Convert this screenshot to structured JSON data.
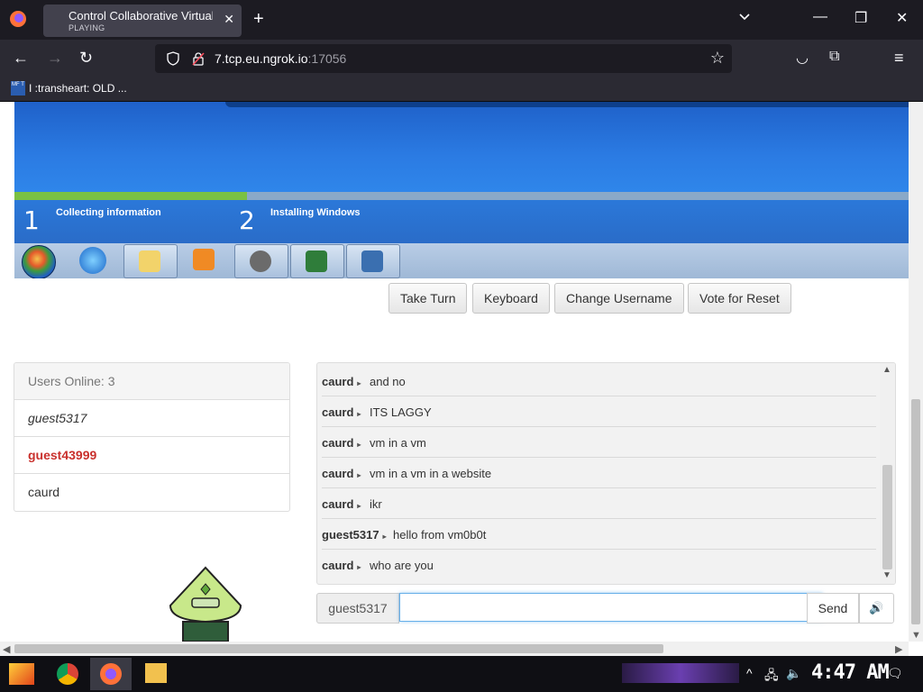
{
  "browser": {
    "tab_title": "Control Collaborative Virtual",
    "tab_subtitle": "PLAYING",
    "url_host": "7.tcp.eu.ngrok.io",
    "url_port": ":17056",
    "bookmark_label": "I :transheart: OLD ...",
    "bookmark_icon_text": "MF T"
  },
  "vm": {
    "progress_fraction": 0.26,
    "steps": [
      {
        "num": "1",
        "label": "Collecting information"
      },
      {
        "num": "2",
        "label": "Installing Windows"
      }
    ]
  },
  "controls": {
    "take_turn": "Take Turn",
    "keyboard": "Keyboard",
    "change_username": "Change Username",
    "vote_reset": "Vote for Reset"
  },
  "users": {
    "header": "Users Online: 3",
    "list": [
      {
        "name": "guest5317"
      },
      {
        "name": "guest43999"
      },
      {
        "name": "caurd"
      }
    ]
  },
  "chat": {
    "messages": [
      {
        "user": "caurd",
        "text": "and no"
      },
      {
        "user": "caurd",
        "text": "ITS LAGGY"
      },
      {
        "user": "caurd",
        "text": "vm in a vm"
      },
      {
        "user": "caurd",
        "text": "vm in a vm in a website"
      },
      {
        "user": "caurd",
        "text": "ikr"
      },
      {
        "user": "guest5317",
        "text": "hello from vm0b0t"
      },
      {
        "user": "caurd",
        "text": "who are you"
      }
    ],
    "username": "guest5317",
    "input_value": "",
    "send_label": "Send"
  },
  "os": {
    "clock": "4:47 AM"
  },
  "colors": {
    "highlight_user": "#c9302c",
    "progress_fill": "#7ac143",
    "chrome_dark": "#1c1b22"
  }
}
